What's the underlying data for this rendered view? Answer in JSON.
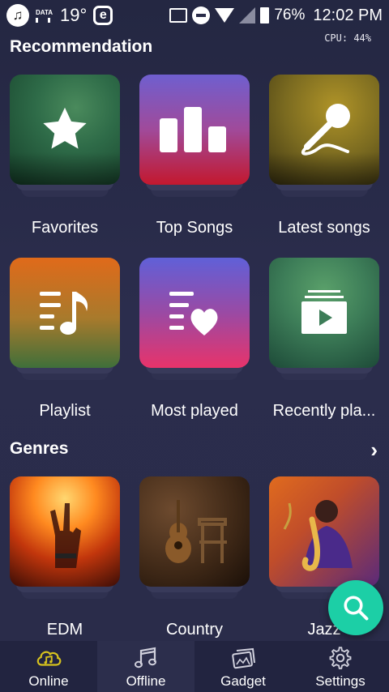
{
  "status_bar": {
    "data_label": "DATA",
    "temperature": "19°",
    "e_badge": "e",
    "battery": "76%",
    "time": "12:02 PM"
  },
  "cpu_readout": "CPU: 44%",
  "sections": {
    "recommendation_title": "Recommendation",
    "genres_title": "Genres"
  },
  "recommendation": [
    {
      "label": "Favorites",
      "icon": "star-icon"
    },
    {
      "label": "Top Songs",
      "icon": "bar-chart-icon"
    },
    {
      "label": "Latest songs",
      "icon": "microphone-icon"
    },
    {
      "label": "Playlist",
      "icon": "playlist-note-icon"
    },
    {
      "label": "Most played",
      "icon": "playlist-heart-icon"
    },
    {
      "label": "Recently pla...",
      "icon": "video-play-icon"
    }
  ],
  "genres": [
    {
      "label": "EDM"
    },
    {
      "label": "Country"
    },
    {
      "label": "Jazz"
    }
  ],
  "nav": [
    {
      "label": "Online",
      "icon": "cloud-music-icon",
      "active": true
    },
    {
      "label": "Offline",
      "icon": "music-notes-icon",
      "active": false
    },
    {
      "label": "Gadget",
      "icon": "cards-icon",
      "active": false
    },
    {
      "label": "Settings",
      "icon": "gear-icon",
      "active": false
    }
  ],
  "colors": {
    "accent": "#1ccfa6",
    "active_nav_icon": "#d6c21e",
    "background": "#2a2c49"
  }
}
